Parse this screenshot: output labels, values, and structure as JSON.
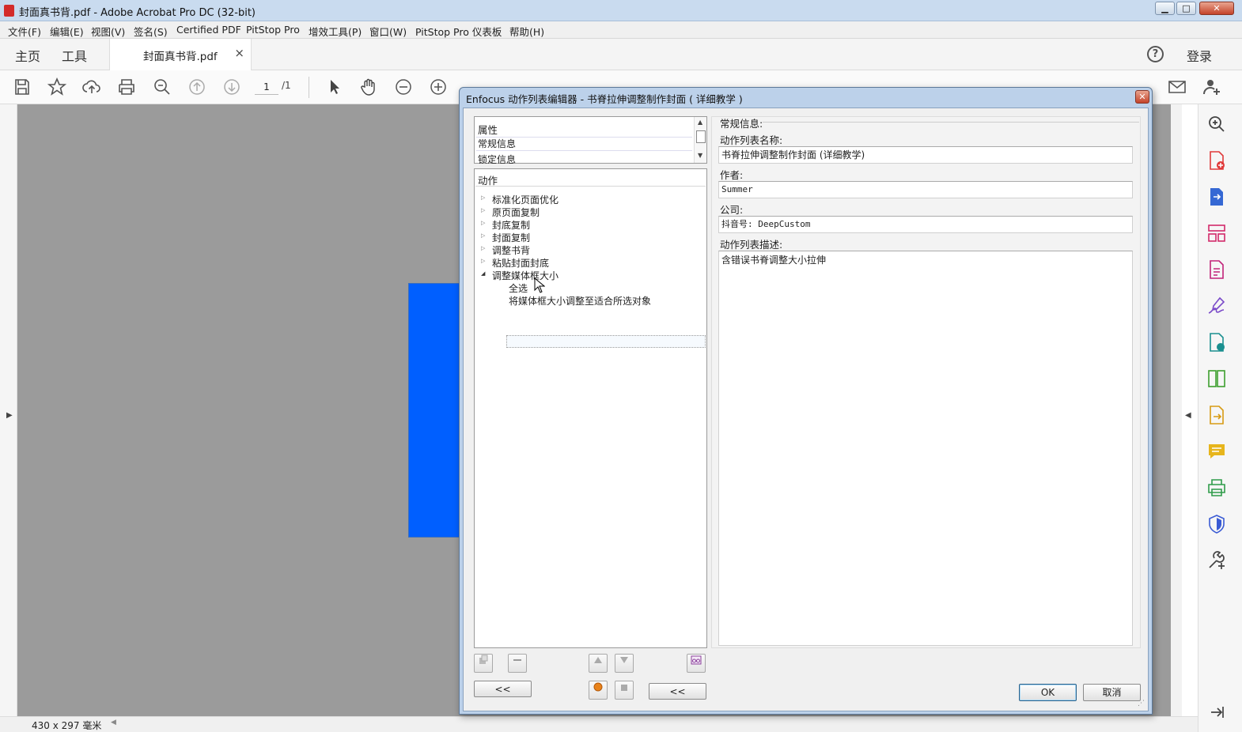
{
  "window": {
    "title": "封面真书背.pdf - Adobe Acrobat Pro DC (32-bit)",
    "min": "▁",
    "max": "□",
    "close": "✕"
  },
  "menu": [
    "文件(F)",
    "编辑(E)",
    "视图(V)",
    "签名(S)",
    "Certified PDF",
    "PitStop Pro",
    "增效工具(P)",
    "窗口(W)",
    "PitStop Pro 仪表板",
    "帮助(H)"
  ],
  "tabs": {
    "home": "主页",
    "tools": "工具",
    "doc": "封面真书背.pdf",
    "close": "×"
  },
  "topright": {
    "help": "?",
    "login": "登录"
  },
  "toolbar": {
    "page_current": "1",
    "page_total": "/1"
  },
  "status": {
    "size": "430 x 297 毫米"
  },
  "dialog": {
    "title": "Enfocus 动作列表编辑器 - 书脊拉伸调整制作封面 ( 详细教学 )",
    "close": "✕",
    "properties": {
      "header": "属性",
      "items": [
        "常规信息",
        "锁定信息"
      ]
    },
    "actions": {
      "header": "动作",
      "groups": [
        "标准化页面优化",
        "原页面复制",
        "封底复制",
        "封面复制",
        "调整书背",
        "粘贴封面封底",
        "调整媒体框大小"
      ],
      "children": [
        "全选",
        "将媒体框大小调整至适合所选对象"
      ]
    },
    "general": {
      "section": "常规信息:",
      "name_label": "动作列表名称:",
      "name_value": "书脊拉伸调整制作封面 (详细教学)",
      "author_label": "作者:",
      "author_value": "Summer",
      "company_label": "公司:",
      "company_value": "抖音号: DeepCustom",
      "desc_label": "动作列表描述:",
      "desc_value": "含错误书脊调整大小拉伸"
    },
    "buttons": {
      "collapse_left": "<<",
      "collapse_right": "<<",
      "ok": "OK",
      "cancel": "取消"
    }
  }
}
